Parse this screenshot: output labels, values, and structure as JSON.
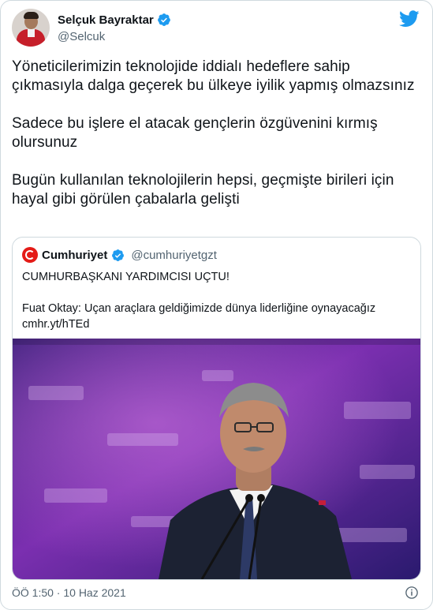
{
  "author": {
    "name": "Selçuk Bayraktar",
    "handle": "@Selcuk"
  },
  "tweet": {
    "paragraphs": [
      "Yöneticilerimizin teknolojide iddialı hedeflere sahip çıkmasıyla dalga geçerek bu ülkeye iyilik yapmış olmazsınız",
      "Sadece bu işlere el atacak gençlerin özgüvenini kırmış olursunuz",
      "Bugün kullanılan teknolojilerin hepsi, geçmişte birileri için hayal gibi görülen çabalarla gelişti"
    ]
  },
  "quote": {
    "name": "Cumhuriyet",
    "handle": "@cumhuriyetgzt",
    "headline": "CUMHURBAŞKANI YARDIMCISI UÇTU!",
    "body": "Fuat Oktay: Uçan araçlara geldiğimizde dünya liderliğine oynayacağız",
    "link": "cmhr.yt/hTEd"
  },
  "footer": {
    "timestamp": "ÖÖ 1:50 · 10 Haz 2021"
  },
  "colors": {
    "twitter_blue": "#1d9bf0",
    "text_primary": "#0f1419",
    "text_secondary": "#536471",
    "border": "#cfd9de"
  },
  "icons": {
    "verified": "verified-badge-icon",
    "brand": "twitter-bird-icon",
    "info": "info-icon"
  }
}
